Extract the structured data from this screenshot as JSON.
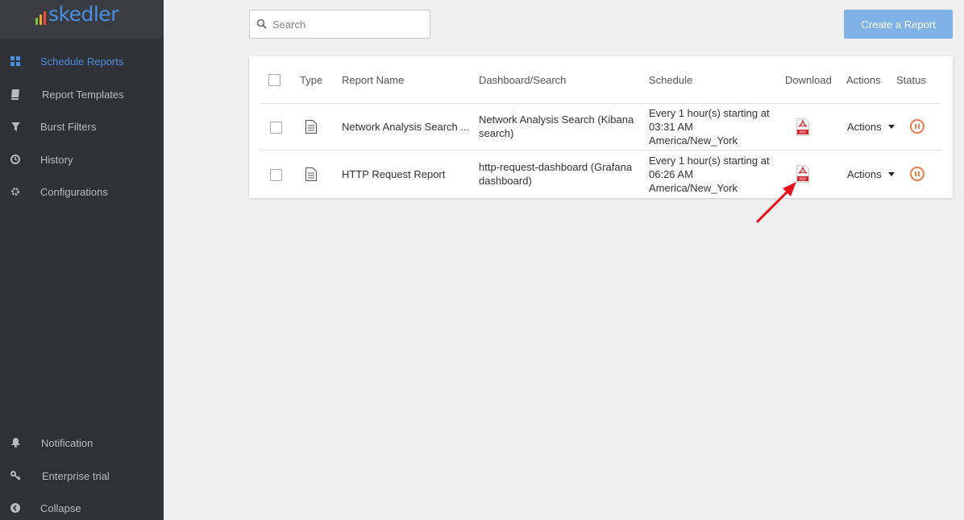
{
  "app": {
    "logo_text": "skedler",
    "logo_colors": [
      "#7dc243",
      "#f5a623",
      "#e94b3c",
      "#4a90e2"
    ]
  },
  "sidebar": {
    "items": [
      {
        "label": "Schedule Reports",
        "icon": "grid-icon",
        "active": true
      },
      {
        "label": "Report Templates",
        "icon": "book-icon",
        "active": false
      },
      {
        "label": "Burst Filters",
        "icon": "filter-icon",
        "active": false
      },
      {
        "label": "History",
        "icon": "clock-icon",
        "active": false
      },
      {
        "label": "Configurations",
        "icon": "gear-icon",
        "active": false
      }
    ],
    "bottom_items": [
      {
        "label": "Notification",
        "icon": "bell-icon"
      },
      {
        "label": "Enterprise trial",
        "icon": "key-icon"
      },
      {
        "label": "Collapse",
        "icon": "chevron-left-circle-icon"
      }
    ]
  },
  "search": {
    "placeholder": "Search",
    "value": ""
  },
  "toolbar": {
    "create_label": "Create a Report"
  },
  "table": {
    "headers": {
      "type": "Type",
      "name": "Report Name",
      "dashboard": "Dashboard/Search",
      "schedule": "Schedule",
      "download": "Download",
      "actions": "Actions",
      "status": "Status"
    },
    "rows": [
      {
        "name": "Network Analysis Search ...",
        "dashboard_line1": "Network Analysis Search (Kibana",
        "dashboard_line2": "search)",
        "schedule_line1": "Every 1 hour(s) starting at",
        "schedule_line2": "03:31 AM",
        "schedule_line3": "America/New_York",
        "download_icon": "pdf-icon",
        "actions_label": "Actions",
        "status_icon": "pause-icon"
      },
      {
        "name": "HTTP Request Report",
        "dashboard_line1": "http-request-dashboard (Grafana",
        "dashboard_line2": "dashboard)",
        "schedule_line1": "Every 1 hour(s) starting at",
        "schedule_line2": "06:26 AM",
        "schedule_line3": "America/New_York",
        "download_icon": "pdf-icon",
        "actions_label": "Actions",
        "status_icon": "pause-icon"
      }
    ]
  },
  "colors": {
    "sidebar_bg": "#2f3136",
    "accent": "#4a90e2",
    "primary_button": "#7fb2e6",
    "status_pause": "#f07a4a",
    "pdf_red": "#d9262e",
    "annotation_arrow": "#e8101a"
  }
}
